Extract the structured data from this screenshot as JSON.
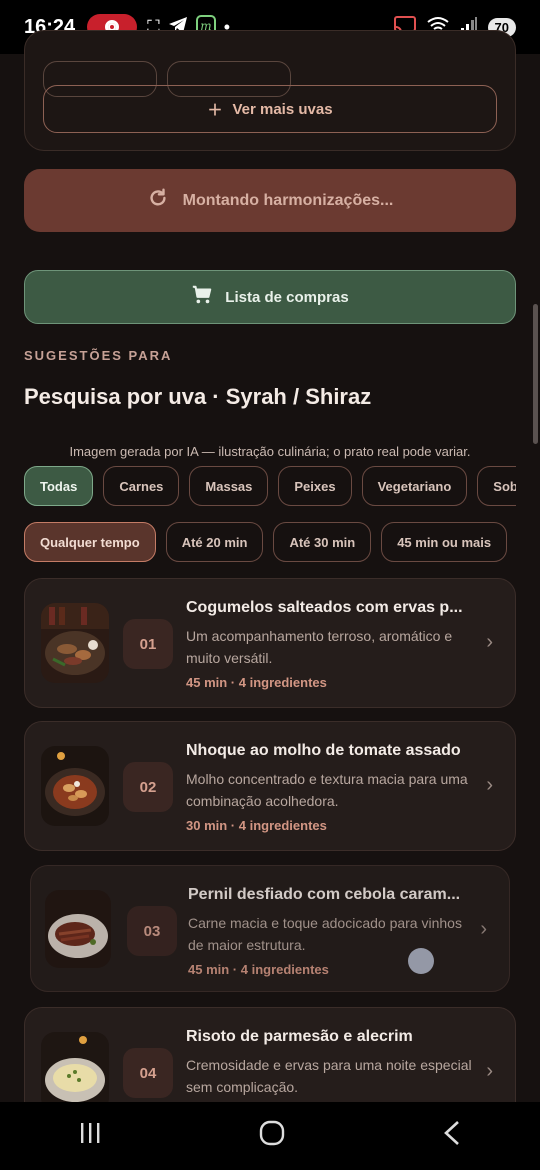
{
  "status_bar": {
    "time": "16:24",
    "battery": "70"
  },
  "top_card": {
    "ver_mais_label": "Ver mais uvas"
  },
  "montando_label": "Montando harmonizações...",
  "lista_label": "Lista de compras",
  "section_label": "SUGESTÕES PARA",
  "page_title": "Pesquisa por uva · Syrah / Shiraz",
  "ia_note": "Imagem gerada por IA — ilustração culinária; o prato real pode variar.",
  "category_filters": [
    "Todas",
    "Carnes",
    "Massas",
    "Peixes",
    "Vegetariano",
    "Sob"
  ],
  "time_filters": [
    "Qualquer tempo",
    "Até 20 min",
    "Até 30 min",
    "45 min ou mais"
  ],
  "recipes": [
    {
      "num": "01",
      "title": "Cogumelos salteados com ervas p...",
      "desc": "Um acompanhamento terroso, aromático e muito versátil.",
      "meta": "45 min · 4 ingredientes"
    },
    {
      "num": "02",
      "title": "Nhoque ao molho de tomate assado",
      "desc": "Molho concentrado e textura macia para uma combinação acolhedora.",
      "meta": "30 min · 4 ingredientes"
    },
    {
      "num": "03",
      "title": "Pernil desfiado com cebola caram...",
      "desc": "Carne macia e toque adocicado para vinhos de maior estrutura.",
      "meta": "45 min · 4 ingredientes"
    },
    {
      "num": "04",
      "title": "Risoto de parmesão e alecrim",
      "desc": "Cremosidade e ervas para uma noite especial sem complicação.",
      "meta": ""
    }
  ]
}
